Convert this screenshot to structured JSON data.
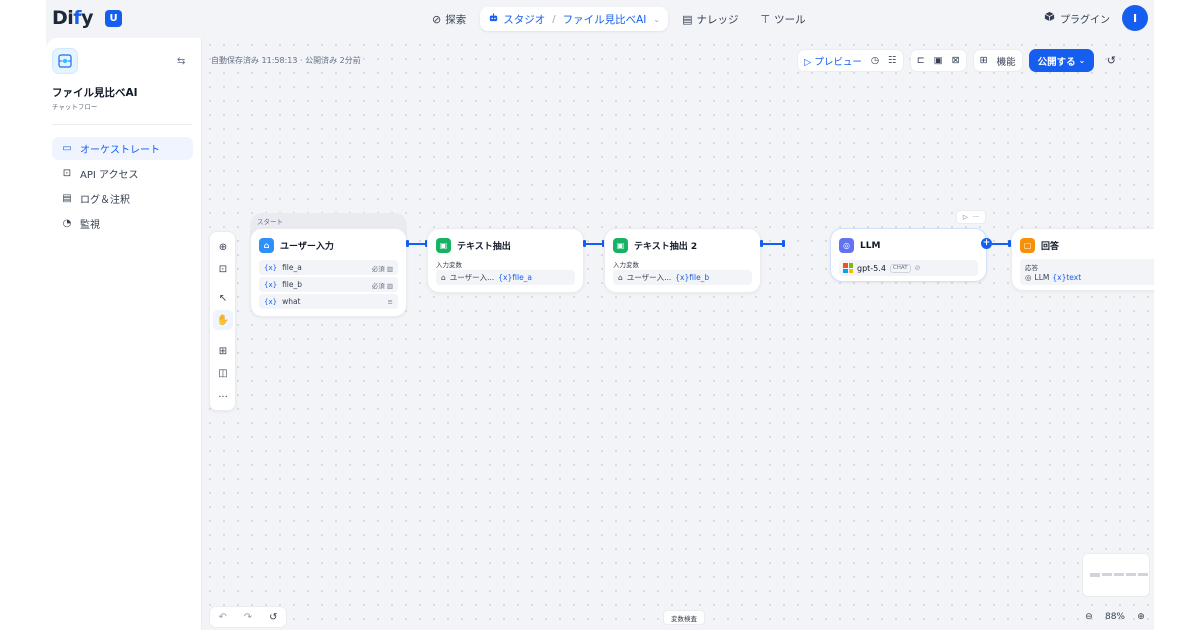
{
  "header": {
    "logo_main": "Di",
    "logo_dot": "f",
    "logo_end": "y",
    "workspace_initial": "U",
    "nav": {
      "explore": "探索",
      "studio": "スタジオ",
      "app_name": "ファイル見比べAI",
      "knowledge": "ナレッジ",
      "tools": "ツール"
    },
    "plugin": "プラグイン",
    "avatar_initial": "I"
  },
  "sidebar": {
    "app_name": "ファイル見比べAI",
    "app_mode": "チャットフロー",
    "items": [
      {
        "label": "オーケストレート",
        "icon": "layout-icon",
        "active": true
      },
      {
        "label": "API アクセス",
        "icon": "terminal-icon",
        "active": false
      },
      {
        "label": "ログ＆注釈",
        "icon": "document-icon",
        "active": false
      },
      {
        "label": "監視",
        "icon": "monitor-icon",
        "active": false
      }
    ]
  },
  "canvas": {
    "autosave": "自動保存済み 11:58:13 · 公開済み 2分前",
    "toolbar": {
      "preview": "プレビュー",
      "features": "機能",
      "publish": "公開する"
    },
    "variable_inspect": "変数検査",
    "zoom": "88%"
  },
  "nodes": {
    "start": {
      "group_label": "スタート",
      "title": "ユーザー入力",
      "vars": [
        {
          "name": "file_a",
          "tag": "必須"
        },
        {
          "name": "file_b",
          "tag": "必須"
        },
        {
          "name": "what",
          "tag": ""
        }
      ]
    },
    "extract1": {
      "title": "テキスト抽出",
      "input_label": "入力変数",
      "ref_node": "ユーザー入...",
      "ref_var": "{x}file_a"
    },
    "extract2": {
      "title": "テキスト抽出 2",
      "input_label": "入力変数",
      "ref_node": "ユーザー入...",
      "ref_var": "{x}file_b"
    },
    "llm": {
      "title": "LLM",
      "model": "gpt-5.4",
      "badge": "CHAT"
    },
    "answer": {
      "title": "回答",
      "label": "応答",
      "ref_node": "LLM",
      "ref_var": "{x}text"
    }
  }
}
